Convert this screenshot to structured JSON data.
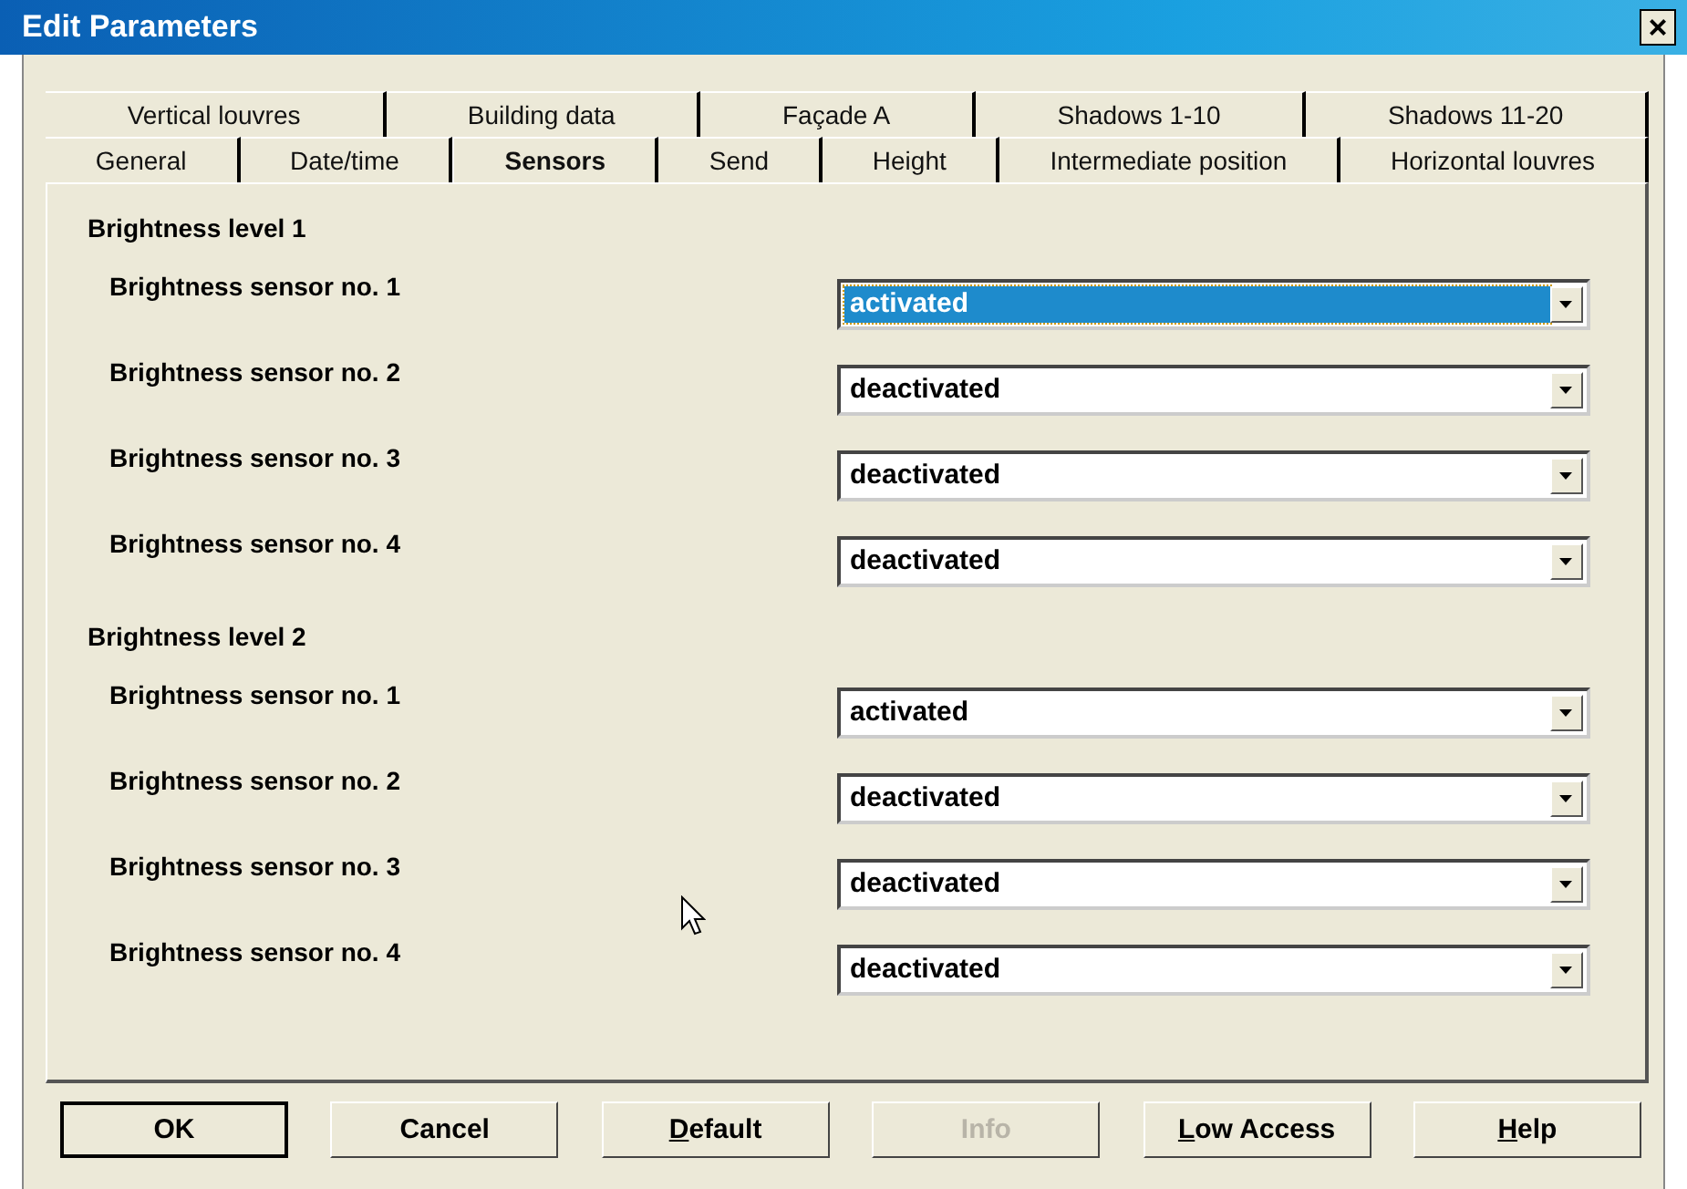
{
  "window": {
    "title": "Edit Parameters",
    "close": "×"
  },
  "tab_rows": [
    [
      {
        "label": "Vertical louvres",
        "selected": false
      },
      {
        "label": "Building data",
        "selected": false
      },
      {
        "label": "Façade A",
        "selected": false
      },
      {
        "label": "Shadows 1-10",
        "selected": false
      },
      {
        "label": "Shadows 11-20",
        "selected": false
      }
    ],
    [
      {
        "label": "General",
        "selected": false
      },
      {
        "label": "Date/time",
        "selected": false
      },
      {
        "label": "Sensors",
        "selected": true
      },
      {
        "label": "Send",
        "selected": false
      },
      {
        "label": "Height",
        "selected": false
      },
      {
        "label": "Intermediate position",
        "selected": false
      },
      {
        "label": "Horizontal louvres",
        "selected": false
      }
    ]
  ],
  "sections": [
    {
      "heading": "Brightness level 1",
      "params": [
        {
          "label": "Brightness sensor no. 1",
          "value": "activated",
          "focused": true
        },
        {
          "label": "Brightness sensor no. 2",
          "value": "deactivated",
          "focused": false
        },
        {
          "label": "Brightness sensor no. 3",
          "value": "deactivated",
          "focused": false
        },
        {
          "label": "Brightness sensor no. 4",
          "value": "deactivated",
          "focused": false
        }
      ]
    },
    {
      "heading": "Brightness level 2",
      "params": [
        {
          "label": "Brightness sensor no. 1",
          "value": "activated",
          "focused": false
        },
        {
          "label": "Brightness sensor no. 2",
          "value": "deactivated",
          "focused": false
        },
        {
          "label": "Brightness sensor no. 3",
          "value": "deactivated",
          "focused": false
        },
        {
          "label": "Brightness sensor no. 4",
          "value": "deactivated",
          "focused": false
        }
      ]
    }
  ],
  "buttons": [
    {
      "label_rest": "OK",
      "default": true,
      "disabled": false
    },
    {
      "label_rest": "Cancel",
      "default": false,
      "disabled": false
    },
    {
      "access_key": "D",
      "label_rest": "efault",
      "default": false,
      "disabled": false
    },
    {
      "label_rest": "Info",
      "default": false,
      "disabled": true
    },
    {
      "access_key": "L",
      "label_rest": "ow Access",
      "default": false,
      "disabled": false
    },
    {
      "access_key": "H",
      "label_rest": "elp",
      "default": false,
      "disabled": false
    }
  ]
}
